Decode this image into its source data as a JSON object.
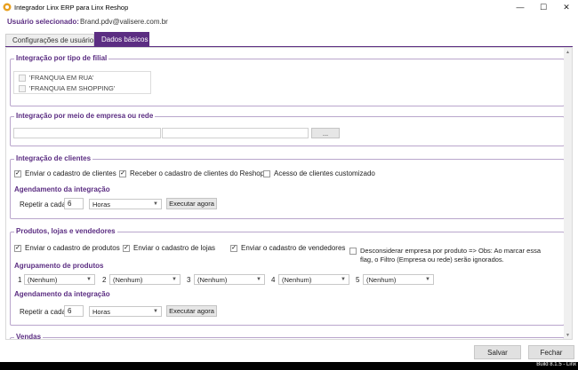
{
  "window": {
    "title": "Integrador Linx ERP para Linx Reshop",
    "minimize": "—",
    "maximize": "☐",
    "close": "✕"
  },
  "user": {
    "label": "Usuário selecionado:",
    "value": "Brand.pdv@valisere.com.br"
  },
  "tabs": [
    {
      "label": "Configurações de usuário",
      "active": false
    },
    {
      "label": "Dados básicos",
      "active": true
    }
  ],
  "filial_group": {
    "title": "Integração por tipo de filial",
    "items": [
      "'FRANQUIA EM RUA'",
      "'FRANQUIA EM SHOPPING'"
    ]
  },
  "empresa_group": {
    "title": "Integração por meio de empresa ou rede",
    "button_label": "..."
  },
  "clientes_group": {
    "title": "Integração de clientes",
    "checks": [
      {
        "label": "Enviar o cadastro de clientes",
        "checked": true
      },
      {
        "label": "Receber o cadastro de clientes do Reshop",
        "checked": true
      },
      {
        "label": "Acesso de clientes customizado",
        "checked": false
      }
    ],
    "schedule_label": "Agendamento da integração",
    "repeat_label": "Repetir a cada",
    "repeat_value": "6",
    "unit": "Horas",
    "run_button": "Executar agora"
  },
  "produtos_group": {
    "title": "Produtos, lojas e vendedores",
    "checks": [
      {
        "label": "Enviar o cadastro de produtos",
        "checked": true
      },
      {
        "label": "Enviar o cadastro de lojas",
        "checked": true
      },
      {
        "label": "Enviar o cadastro de vendedores",
        "checked": true
      }
    ],
    "desconsiderar": {
      "line1": "Desconsiderar empresa por produto => Obs: Ao marcar essa",
      "line2": "flag, o Filtro (Empresa ou rede) serão ignorados.",
      "checked": false
    },
    "grouping_label": "Agrupamento de produtos",
    "groupings": [
      {
        "index": "1",
        "value": "(Nenhum)"
      },
      {
        "index": "2",
        "value": "(Nenhum)"
      },
      {
        "index": "3",
        "value": "(Nenhum)"
      },
      {
        "index": "4",
        "value": "(Nenhum)"
      },
      {
        "index": "5",
        "value": "(Nenhum)"
      }
    ],
    "schedule_label": "Agendamento da integração",
    "repeat_label": "Repetir a cada",
    "repeat_value": "6",
    "unit": "Horas",
    "run_button": "Executar agora"
  },
  "vendas_group": {
    "title": "Vendas"
  },
  "footer": {
    "save": "Salvar",
    "close": "Fechar",
    "build": "Build 8.1.5 - Linx"
  },
  "colors": {
    "accent": "#5b2d82"
  }
}
